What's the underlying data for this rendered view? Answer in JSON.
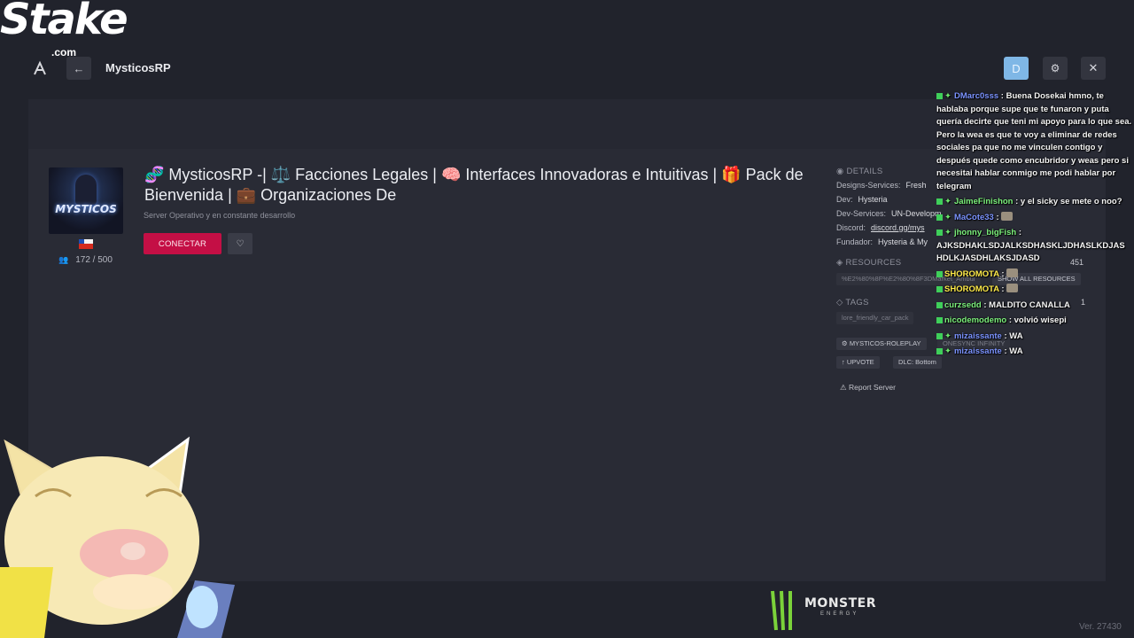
{
  "overlay": {
    "stake_logo": "Stake",
    "stake_domain": ".com",
    "monster_logo": "MONSTER",
    "monster_sub": "ENERGY"
  },
  "topbar": {
    "back_icon": "←",
    "server_name": "MysticosRP",
    "avatar_letter": "D",
    "settings_icon": "⚙",
    "close_icon": "✕"
  },
  "server": {
    "logo_text": "MYSTICOS",
    "title": "🧬 MysticosRP -| ⚖️ Facciones Legales | 🧠 Interfaces Innovadoras e Intuitivas | 🎁 Pack de Bienvenida | 💼 Organizaciones De",
    "subtitle": "Server Operativo y en constante desarrollo",
    "players": "172 / 500",
    "connect_label": "CONECTAR",
    "fav_icon": "♡"
  },
  "details": {
    "header": "DETAILS",
    "rows": [
      {
        "key": "Designs-Services:",
        "value": "Fresh"
      },
      {
        "key": "Dev:",
        "value": "Hysteria"
      },
      {
        "key": "Dev-Services:",
        "value": "UN-Developm"
      },
      {
        "key": "Discord:",
        "value": "discord.gg/mys"
      },
      {
        "key": "Fundador:",
        "value": "Hysteria & My"
      }
    ],
    "resources_header": "RESOURCES",
    "resources_chip": "%E2%80%8F%E2%80%8F3DMarket_Ambul",
    "resources_count": "451",
    "show_all_resources": "SHOW ALL RESOURCES",
    "resources_small_count": "1",
    "tags_header": "TAGS",
    "tag_1": "lore_friendly_car_pack",
    "tag_roleplay": "MYSTICOS-ROLEPLAY",
    "tag_onesync": "ONESYNC INFINITY",
    "upvote_label": "UPVOTE",
    "dlc_label": "DLC: Bottom",
    "report_label": "Report Server"
  },
  "chat": [
    {
      "user": "DMarc0sss",
      "color": "#7b93ff",
      "text": ": Buena Dosekai hmno, te hablaba porque supe que te funaron y puta quería decirte que teni mi apoyo para lo que sea. Pero la wea es que te voy a eliminar de redes sociales pa que no me vinculen contigo y después quede como encubridor y weas pero si necesitai hablar conmigo me podi hablar por telegram"
    },
    {
      "user": "JaimeFinishon",
      "color": "#7cf07c",
      "text": ": y el sicky se mete o noo?"
    },
    {
      "user": "MaCote33",
      "color": "#7b93ff",
      "text": ":"
    },
    {
      "user": "jhonny_bigFish",
      "color": "#7cf07c",
      "text": ": AJKSDHAKLSDJALKSDHASKLJDHASLKDJAS HDLKJASDHLAKSJDASD"
    },
    {
      "user": "SHOROMOTA",
      "color": "#ffeb4a",
      "text": ":"
    },
    {
      "user": "SHOROMOTA",
      "color": "#ffeb4a",
      "text": ":"
    },
    {
      "user": "curzsedd",
      "color": "#7cf07c",
      "text": ": MALDITO CANALLA"
    },
    {
      "user": "nicodemodemo",
      "color": "#7cf07c",
      "text": ": volvió wisepi"
    },
    {
      "user": "mizaissante",
      "color": "#7b93ff",
      "text": ": WA"
    },
    {
      "user": "mizaissante",
      "color": "#7b93ff",
      "text": ": WA"
    }
  ],
  "version": "Ver. 27430"
}
